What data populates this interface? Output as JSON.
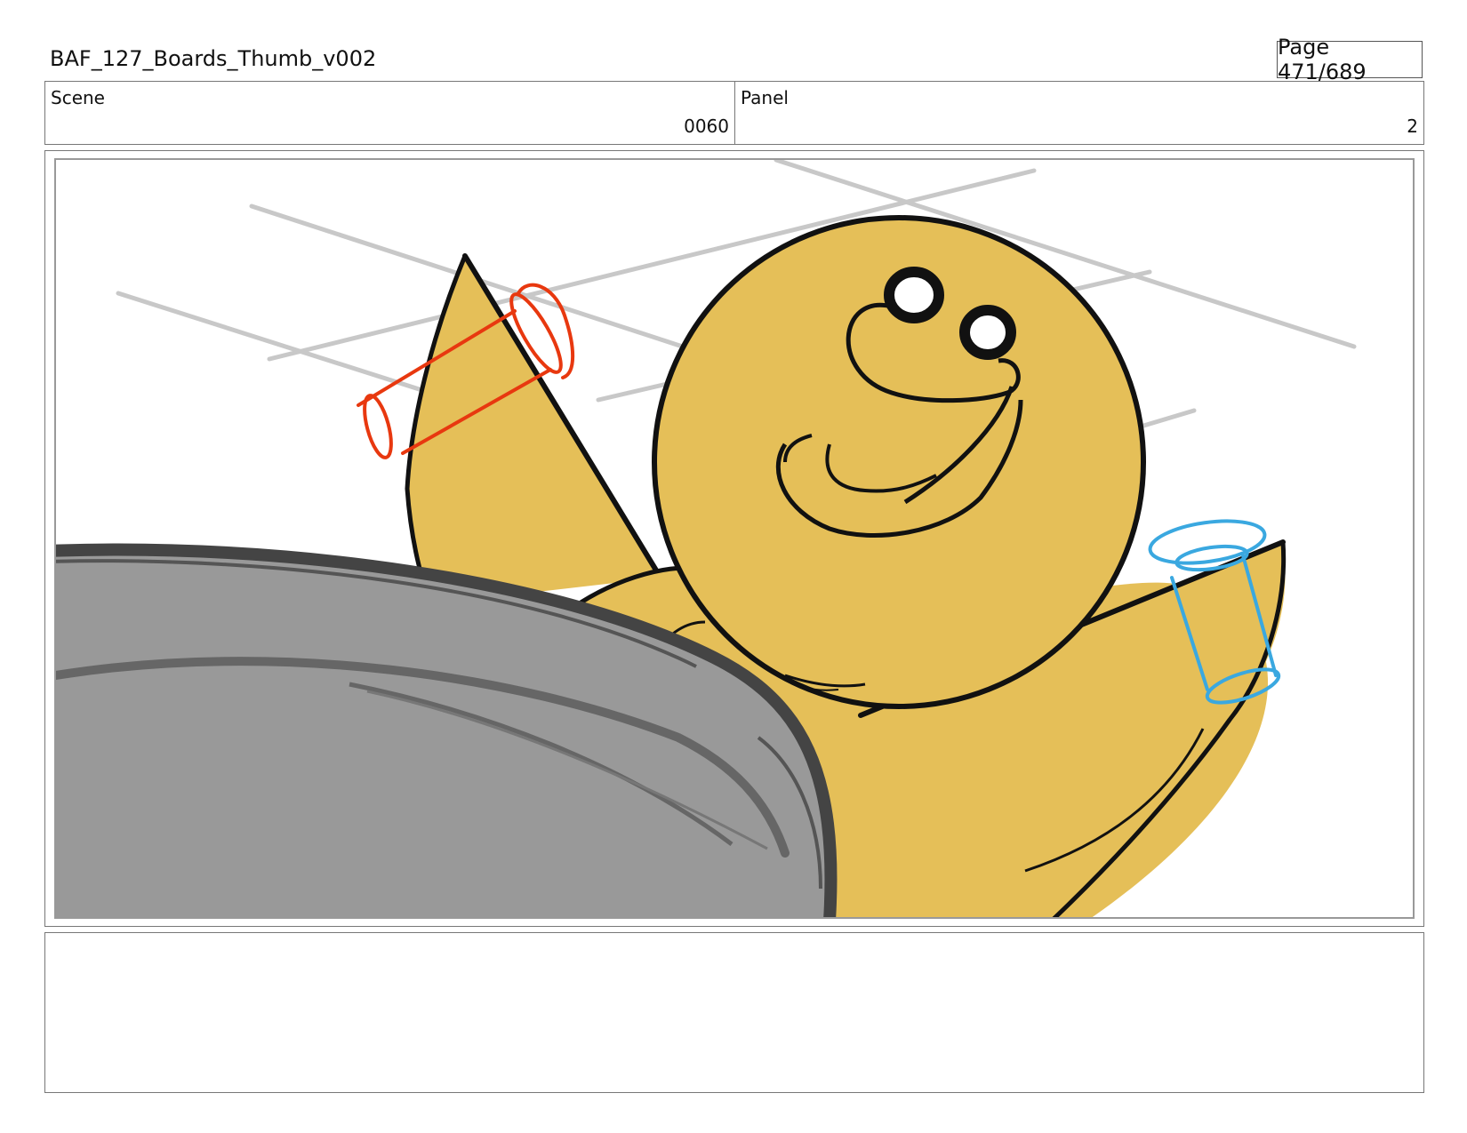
{
  "document": {
    "title": "BAF_127_Boards_Thumb_v002",
    "page": "Page 471/689"
  },
  "info": {
    "scene_label": "Scene",
    "scene_value": "0060",
    "panel_label": "Panel",
    "panel_value": "2"
  },
  "colors": {
    "character_fill": "#e5bf58",
    "line": "#111111",
    "sketch_grey": "#c8c8c8",
    "pan_fill": "#999999",
    "pan_line": "#444444",
    "cuff_left": "#e8380f",
    "cuff_right": "#3aa8e0"
  }
}
